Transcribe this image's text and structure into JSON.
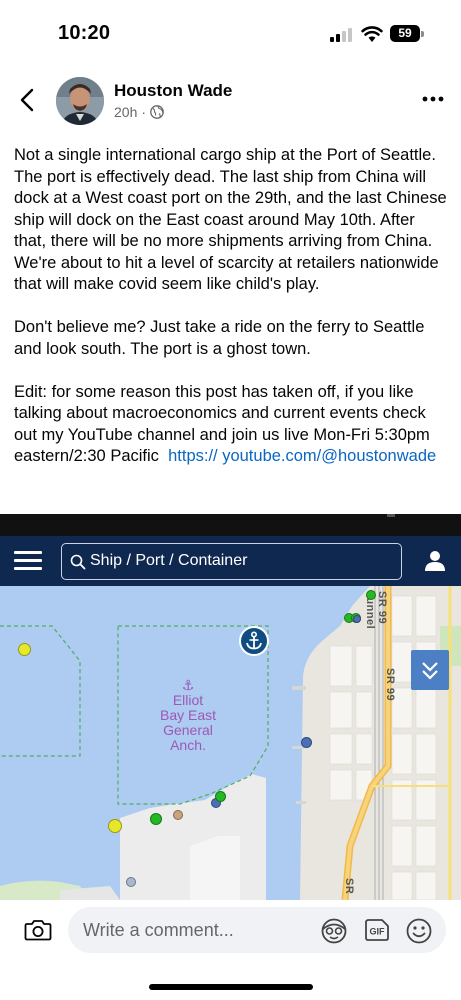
{
  "status_bar": {
    "time": "10:20",
    "battery": "59"
  },
  "post": {
    "author": "Houston Wade",
    "time_ago": "20h",
    "meta_separator": "·",
    "visibility_icon": "globe-icon",
    "paragraphs": [
      "Not a single international cargo ship at the Port of Seattle. The port is effectively dead. The last ship from China will dock at a West coast port on the 29th, and the last Chinese ship will dock on the East coast around May 10th. After that, there will be no more shipments arriving from China. We're about to hit a level of scarcity at retailers nationwide that will make covid seem like child's play.",
      "Don't believe me? Just take a ride on the ferry to Seattle and look south. The port is a ghost town."
    ],
    "edit_text": "Edit: for some reason this post has taken off, if you like talking about macroeconomics and current events check out my YouTube channel and join us live Mon-Fri 5:30pm eastern/2:30 Pacific",
    "link_text": "https:// youtube.com/@houstonwade",
    "link_color": "#0a66c2"
  },
  "screenshot": {
    "search_placeholder": "Ship / Port / Container",
    "map_label": {
      "glyph": "⚓",
      "lines": [
        "Elliot",
        "Bay East",
        "General",
        "Anch."
      ]
    },
    "street_labels": [
      "SR 99 Tunnel",
      "SR 99",
      "SR"
    ],
    "nav_color": "#0f2850",
    "water_color": "#aecbf1",
    "vessel_colors": [
      "#e8e82a",
      "#25b825",
      "#4d6fb8",
      "#c9a37b",
      "#a9b7cf"
    ]
  },
  "comment_bar": {
    "placeholder": "Write a comment..."
  }
}
